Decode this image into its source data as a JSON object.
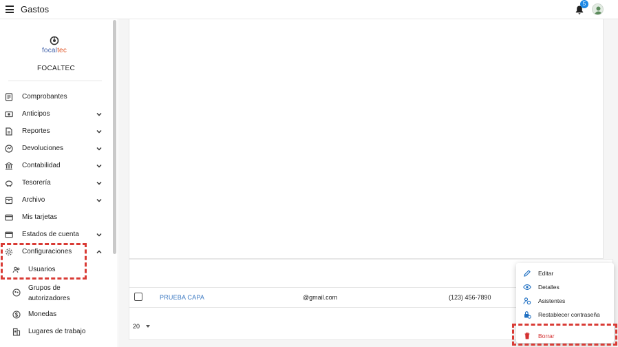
{
  "header": {
    "title": "Gastos",
    "notifications_count": "5"
  },
  "sidebar": {
    "logo": {
      "text_a": "focal",
      "text_b": "tec"
    },
    "company": "FOCALTEC",
    "items": [
      {
        "label": "Comprobantes",
        "icon": "receipt-icon",
        "expandable": false
      },
      {
        "label": "Anticipos",
        "icon": "cash-icon",
        "expandable": true
      },
      {
        "label": "Reportes",
        "icon": "report-icon",
        "expandable": true
      },
      {
        "label": "Devoluciones",
        "icon": "refund-icon",
        "expandable": true
      },
      {
        "label": "Contabilidad",
        "icon": "bank-icon",
        "expandable": true
      },
      {
        "label": "Tesorería",
        "icon": "piggy-bank-icon",
        "expandable": true
      },
      {
        "label": "Archivo",
        "icon": "archive-icon",
        "expandable": true
      },
      {
        "label": "Mis tarjetas",
        "icon": "credit-card-icon",
        "expandable": false
      },
      {
        "label": "Estados de cuenta",
        "icon": "wallet-icon",
        "expandable": true
      },
      {
        "label": "Configuraciones",
        "icon": "gear-icon",
        "expandable": true,
        "expanded": true
      }
    ],
    "subitems": [
      {
        "label": "Usuarios",
        "icon": "users-icon"
      },
      {
        "label": "Grupos de autorizadores",
        "label_line1": "Grupos de",
        "label_line2": "autorizadores",
        "icon": "groups-icon"
      },
      {
        "label": "Monedas",
        "icon": "currency-icon"
      },
      {
        "label": "Lugares de trabajo",
        "icon": "building-icon"
      }
    ]
  },
  "table": {
    "rows": [
      {
        "name": "PRUEBA CAPA",
        "email": "@gmail.com",
        "phone": "(123) 456-7890"
      }
    ],
    "page_size": "20"
  },
  "context_menu": {
    "items": [
      {
        "label": "Editar",
        "icon": "pencil-icon"
      },
      {
        "label": "Detalles",
        "icon": "eye-icon"
      },
      {
        "label": "Asistentes",
        "icon": "assistants-icon"
      },
      {
        "label": "Restablecer contraseña",
        "icon": "lock-reset-icon"
      },
      {
        "label": "Borrar",
        "icon": "trash-icon"
      }
    ]
  },
  "colors": {
    "accent": "#1e88e5",
    "link": "#3a78c2",
    "danger": "#d32f2f",
    "highlight": "#d93b35"
  }
}
